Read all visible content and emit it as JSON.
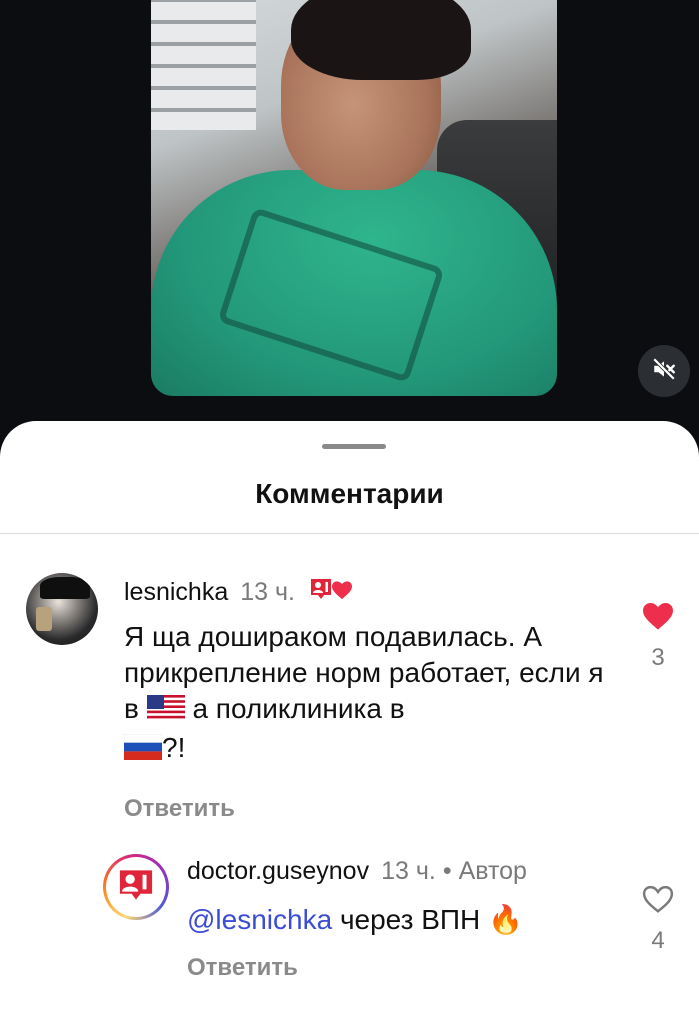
{
  "sheet": {
    "title": "Комментарии"
  },
  "comments": [
    {
      "username": "lesnichka",
      "time": "13 ч.",
      "text_part1": "Я ща дошираком подавилась. А прикрепление норм работает, если я в",
      "text_part2": "а поликлиника в",
      "text_part3": "?!",
      "flag_1": "US flag",
      "flag_2": "Russia flag",
      "reply_label": "Ответить",
      "likes": "3",
      "liked": true
    },
    {
      "username": "doctor.guseynov",
      "time": "13 ч.",
      "separator": "•",
      "author_label": "Автор",
      "mention": "@lesnichka",
      "text": "через ВПН",
      "emoji": "🔥",
      "reply_label": "Ответить",
      "likes": "4",
      "liked": false
    }
  ],
  "colors": {
    "like_red": "#ed2f4b",
    "mention_blue": "#3b4cd6",
    "badge_red": "#e0253a"
  }
}
